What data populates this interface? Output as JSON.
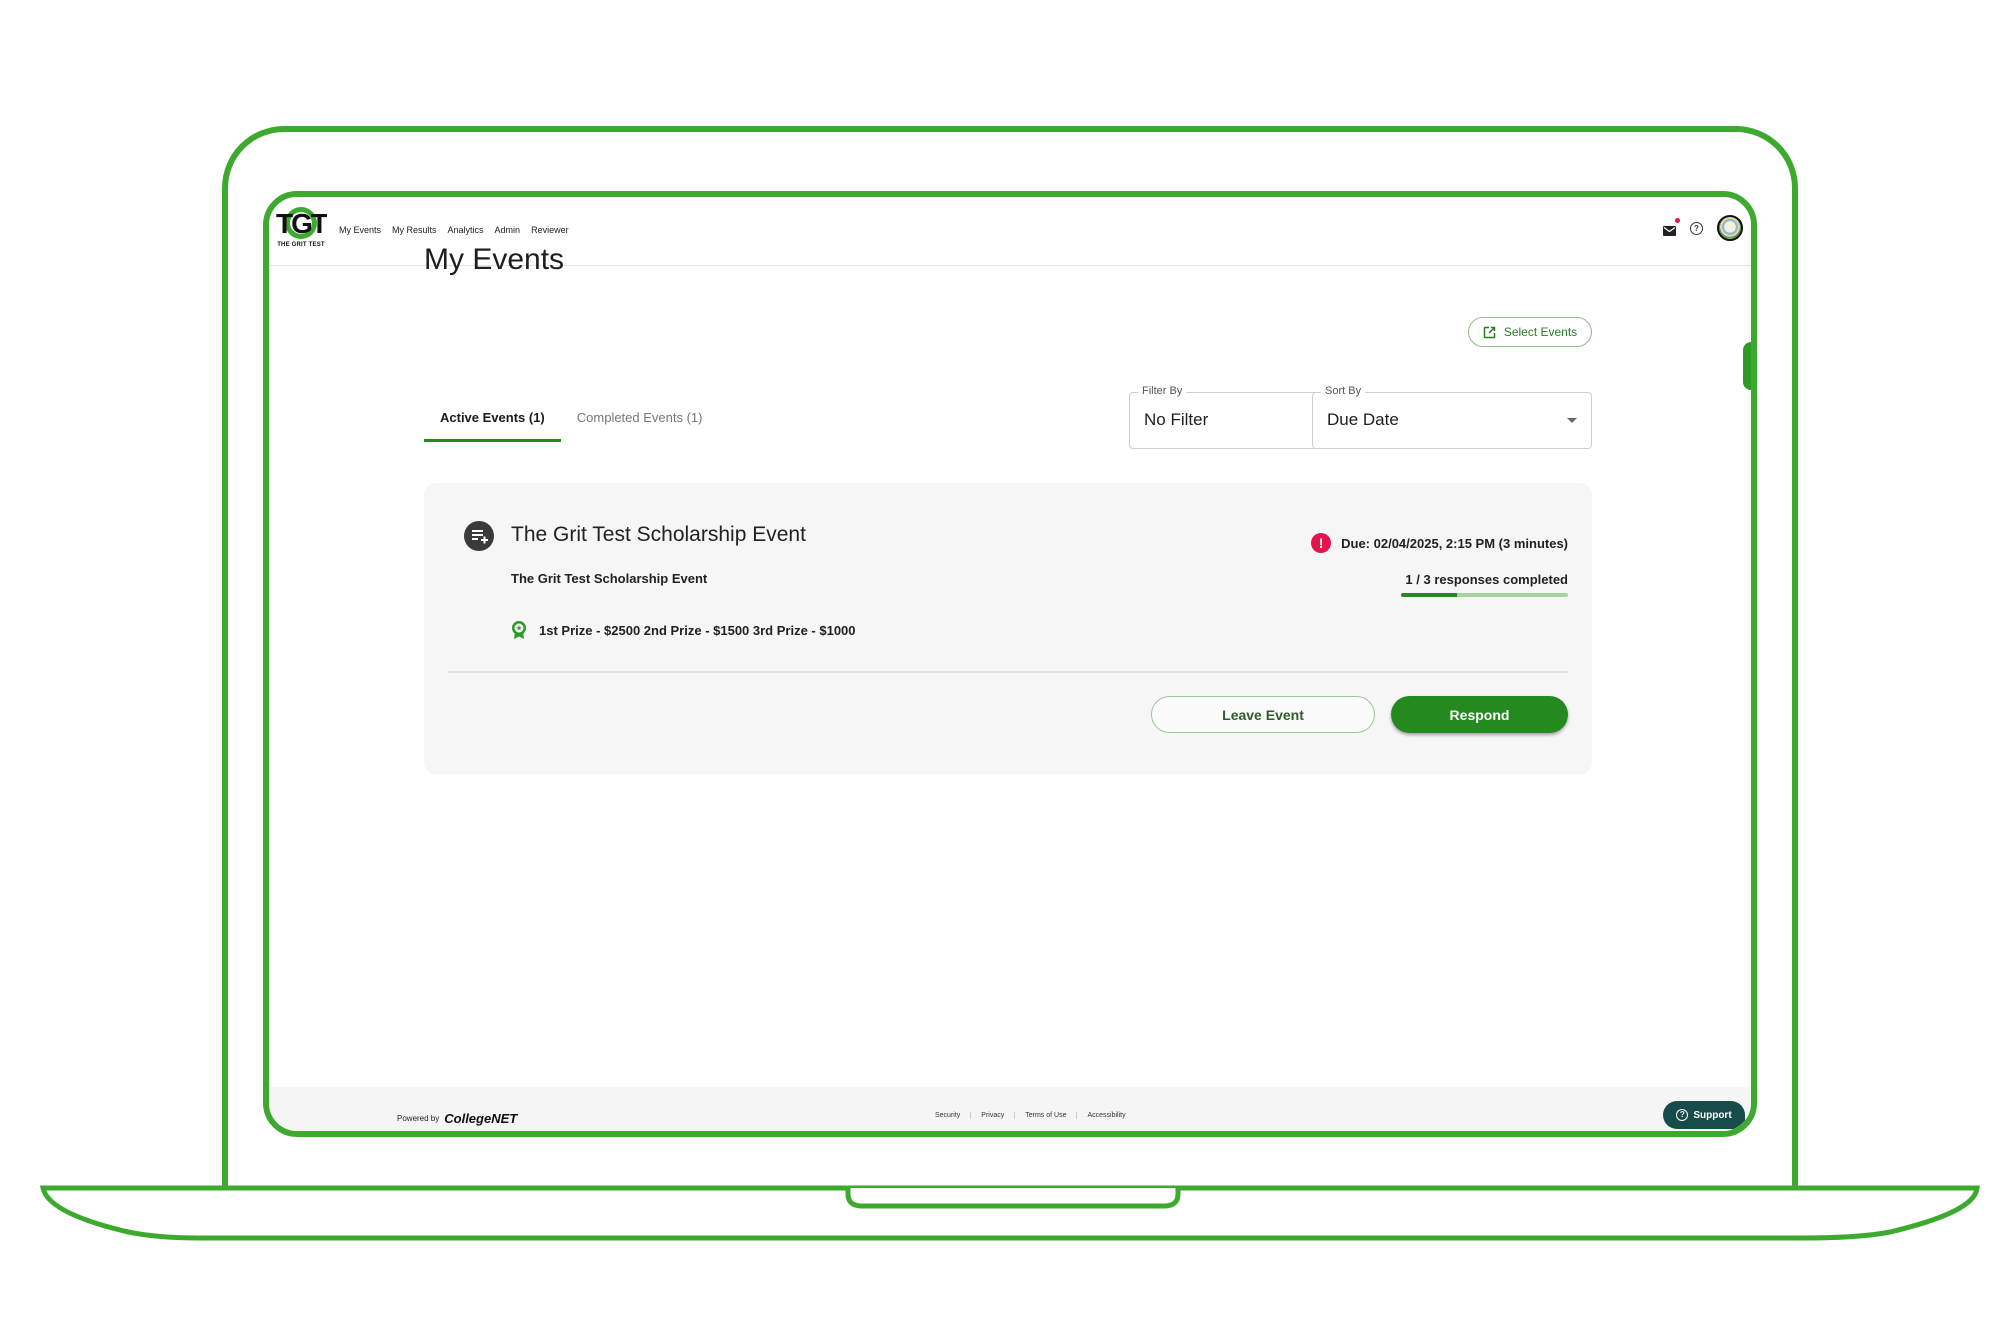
{
  "app": {
    "logo_text": "TGT",
    "logo_subtitle": "THE GRIT TEST"
  },
  "nav": {
    "items": [
      {
        "label": "My Events"
      },
      {
        "label": "My Results"
      },
      {
        "label": "Analytics"
      },
      {
        "label": "Admin"
      },
      {
        "label": "Reviewer"
      }
    ],
    "icons": {
      "mail": "mail-icon",
      "help": "help-icon",
      "help_glyph": "?",
      "avatar": "avatar"
    },
    "mail_has_notification": true
  },
  "page": {
    "title": "My Events",
    "select_events_label": "Select Events",
    "tabs": [
      {
        "label": "Active Events (1)",
        "active": true
      },
      {
        "label": "Completed Events (1)",
        "active": false
      }
    ],
    "filter": {
      "label": "Filter By",
      "value": "No Filter"
    },
    "sort": {
      "label": "Sort By",
      "value": "Due Date"
    }
  },
  "event_card": {
    "title": "The Grit Test Scholarship Event",
    "subtitle": "The Grit Test Scholarship Event",
    "prizes": "1st Prize - $2500 2nd Prize - $1500 3rd Prize - $1000",
    "due": "Due: 02/04/2025, 2:15 PM (3 minutes)",
    "due_icon_glyph": "!",
    "progress_text": "1 / 3 responses completed",
    "progress": {
      "completed": 1,
      "total": 3
    },
    "leave_label": "Leave Event",
    "respond_label": "Respond"
  },
  "footer": {
    "powered_by": "Powered by",
    "brand": "CollegeNET",
    "links": [
      "Security",
      "Privacy",
      "Terms of Use",
      "Accessibility"
    ],
    "support_label": "Support",
    "support_glyph": "?"
  },
  "colors": {
    "frame_green": "#3daa2f",
    "primary_green": "#248a1f",
    "alert_red": "#e5154c",
    "support_teal": "#184c4b",
    "card_bg": "#f6f6f6"
  }
}
